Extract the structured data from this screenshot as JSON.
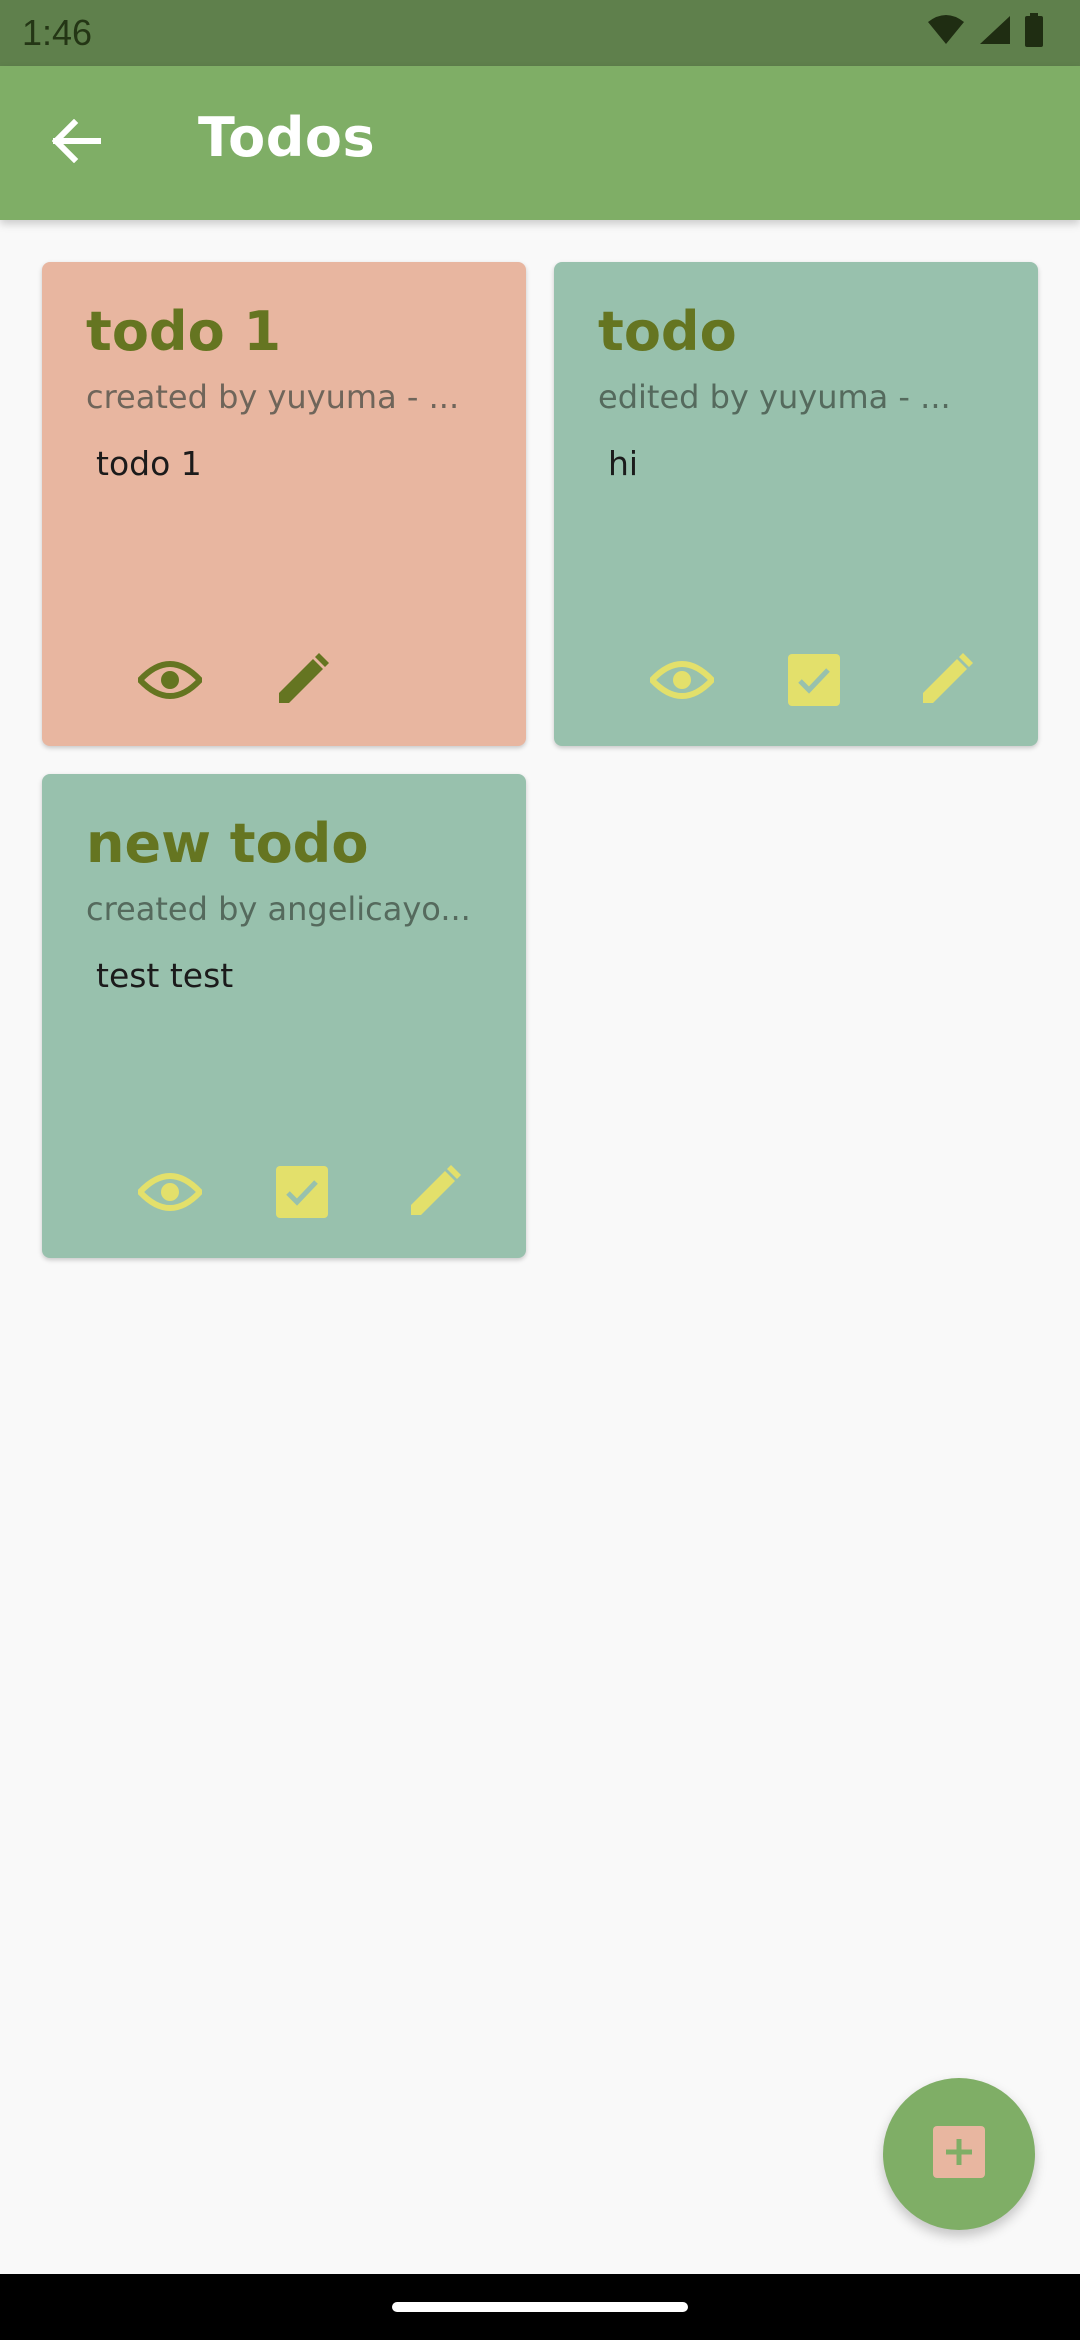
{
  "status_bar": {
    "time": "1:46",
    "icons": [
      "wifi-icon",
      "cell-signal-icon",
      "battery-icon"
    ]
  },
  "app_bar": {
    "title": "Todos",
    "back_icon": "arrow-back-icon"
  },
  "colors": {
    "status_bar": "#5f804c",
    "app_bar": "#7fae66",
    "card_pink": "#e8b6a0",
    "card_teal": "#98c1ad",
    "title_text": "#657521",
    "icon_dark": "#657521",
    "icon_yellow": "#e3e06b",
    "fab": "#7fae66",
    "fab_icon_bg": "#e8b6a0"
  },
  "todos": [
    {
      "title": "todo 1",
      "subtitle": "created by yuyuma - ...",
      "body": "todo 1",
      "color": "pink",
      "actions": [
        "view",
        "edit"
      ]
    },
    {
      "title": "todo",
      "subtitle": "edited by yuyuma - ...",
      "body": "hi",
      "color": "teal",
      "actions": [
        "view",
        "complete",
        "edit"
      ]
    },
    {
      "title": "new todo",
      "subtitle": "created by angelicayo...",
      "body": "test test",
      "color": "teal",
      "actions": [
        "view",
        "complete",
        "edit"
      ]
    }
  ],
  "fab": {
    "icon": "add-icon"
  }
}
